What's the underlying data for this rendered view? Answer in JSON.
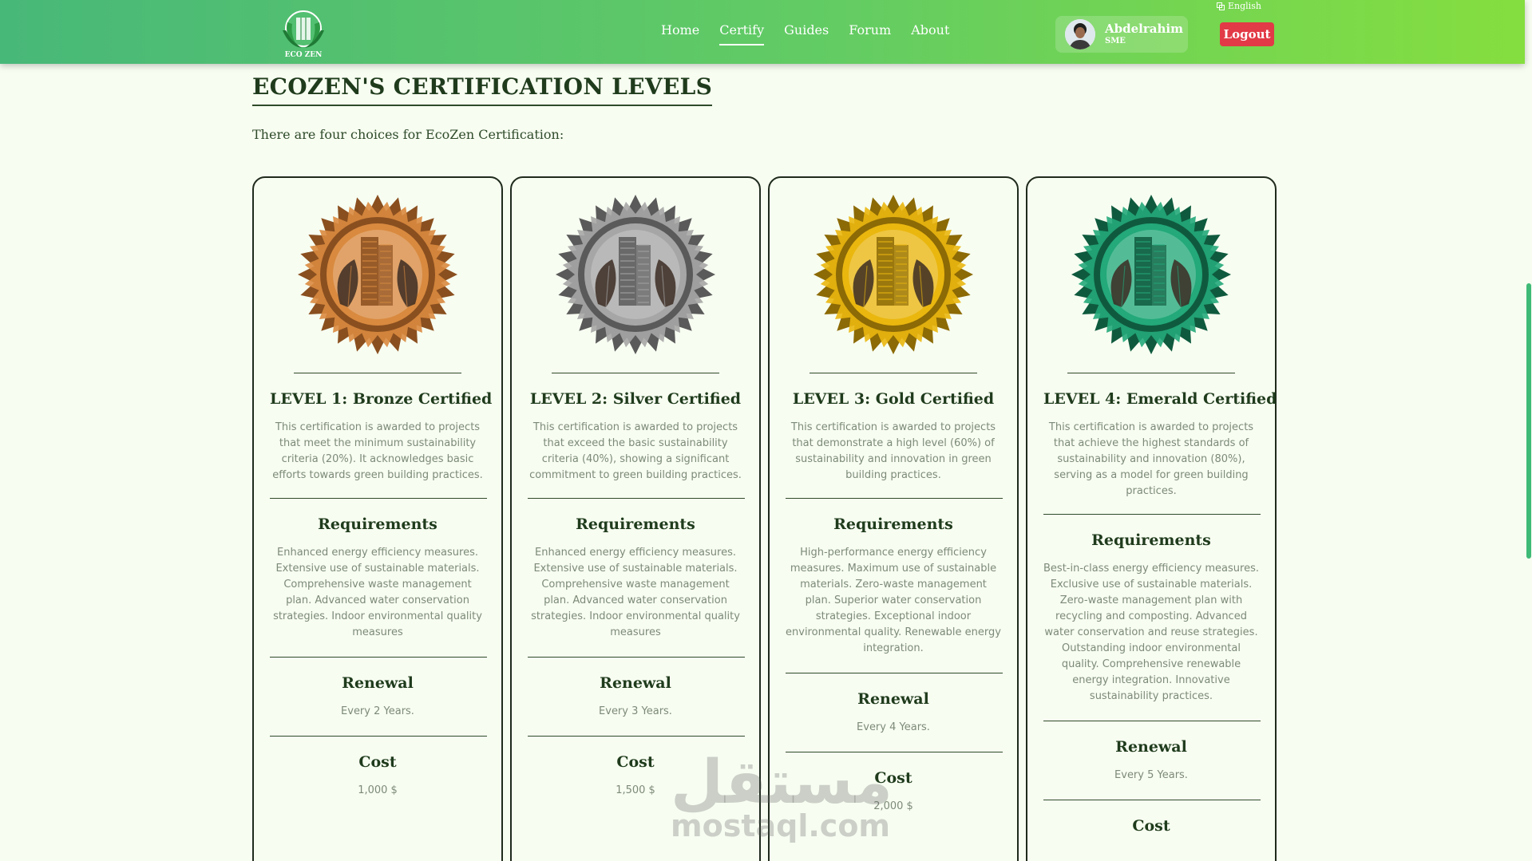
{
  "nav": {
    "logo_text": "ECO ZEN",
    "links": [
      "Home",
      "Certify",
      "Guides",
      "Forum",
      "About"
    ],
    "active": "Certify",
    "user_name": "Abdelrahim",
    "user_role": "SME",
    "logout_label": "Logout",
    "language": "English",
    "accent_color": "#e23a46"
  },
  "page": {
    "title": "ECOZEN'S CERTIFICATION LEVELS",
    "intro": "There are four choices for EcoZen Certification:"
  },
  "labels": {
    "requirements": "Requirements",
    "renewal": "Renewal",
    "cost": "Cost"
  },
  "levels": [
    {
      "title": "LEVEL 1: Bronze Certified",
      "description": "This certification is awarded to projects that meet the minimum sustainability criteria (20%). It acknowledges basic efforts towards green building practices.",
      "requirements": "Enhanced energy efficiency measures. Extensive use of sustainable materials. Comprehensive waste management plan. Advanced water conservation strategies. Indoor environmental quality measures",
      "renewal": "Every 2 Years.",
      "cost": "1,000 $",
      "badge_color": "#d98a3f",
      "badge_dark": "#8a4f1f"
    },
    {
      "title": "LEVEL 2: Silver Certified",
      "description": "This certification is awarded to projects that exceed the basic sustainability criteria (40%), showing a significant commitment to green building practices.",
      "requirements": "Enhanced energy efficiency measures. Extensive use of sustainable materials. Comprehensive waste management plan. Advanced water conservation strategies. Indoor environmental quality measures",
      "renewal": "Every 3 Years.",
      "cost": "1,500 $",
      "badge_color": "#a6a6a6",
      "badge_dark": "#5a5a5a"
    },
    {
      "title": "LEVEL 3: Gold Certified",
      "description": "This certification is awarded to projects that demonstrate a high level (60%) of sustainability and innovation in green building practices.",
      "requirements": "High-performance energy efficiency measures. Maximum use of sustainable materials. Zero-waste management plan. Superior water conservation strategies. Exceptional indoor environmental quality. Renewable energy integration.",
      "renewal": "Every 4 Years.",
      "cost": "2,000 $",
      "badge_color": "#eab70f",
      "badge_dark": "#8c6a05"
    },
    {
      "title": "LEVEL 4: Emerald Certified",
      "description": "This certification is awarded to projects that achieve the highest standards of sustainability and innovation (80%), serving as a model for green building practices.",
      "requirements": "Best-in-class energy efficiency measures. Exclusive use of sustainable materials. Zero-waste management plan with recycling and composting. Advanced water conservation and reuse strategies. Outstanding indoor environmental quality. Comprehensive renewable energy integration. Innovative sustainability practices.",
      "renewal": "Every 5 Years.",
      "cost": "",
      "badge_color": "#23a97a",
      "badge_dark": "#0f5a3e"
    }
  ],
  "watermark": {
    "arabic": "مستقل",
    "latin": "mostaql.com"
  }
}
